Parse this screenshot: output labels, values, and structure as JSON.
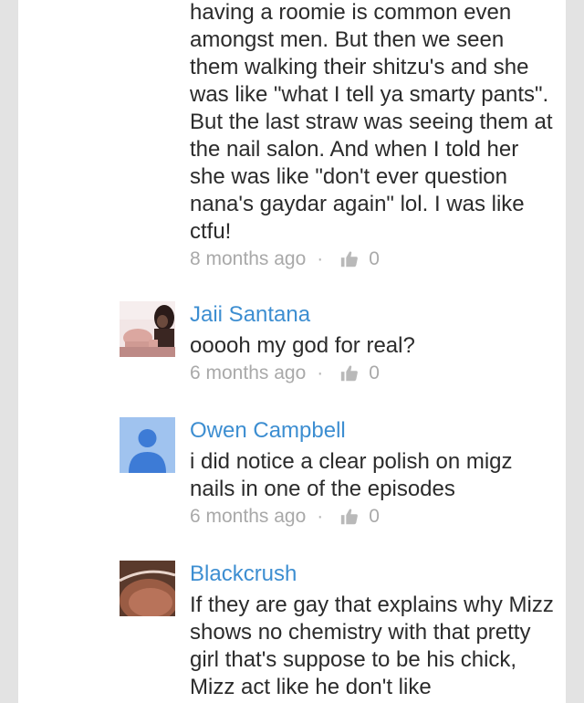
{
  "comments": [
    {
      "text": "having a roomie is common even amongst men. But then we seen them walking their shitzu's and she was like \"what I tell ya smarty pants\". But the last straw was seeing them at the nail salon. And when I told her she was like \"don't ever question nana's gaydar again\" lol. I was like ctfu!",
      "time": "8 months ago",
      "likes": "0"
    },
    {
      "author": "Jaii Santana",
      "text": "ooooh my god for real?",
      "time": "6 months ago",
      "likes": "0"
    },
    {
      "author": "Owen Campbell",
      "text": "i did notice a clear polish on migz nails in one of the episodes",
      "time": "6 months ago",
      "likes": "0"
    },
    {
      "author": "Blackcrush",
      "text": "If they are gay that explains why Mizz shows no chemistry with that pretty girl that's suppose to be his chick, Mizz act like he don't like"
    }
  ],
  "separator": "·",
  "colors": {
    "author": "#3d8ed1",
    "text": "#2b2b2b",
    "meta": "#a9a9a9",
    "page_bg": "#e3e3e3",
    "card_bg": "#ffffff"
  }
}
